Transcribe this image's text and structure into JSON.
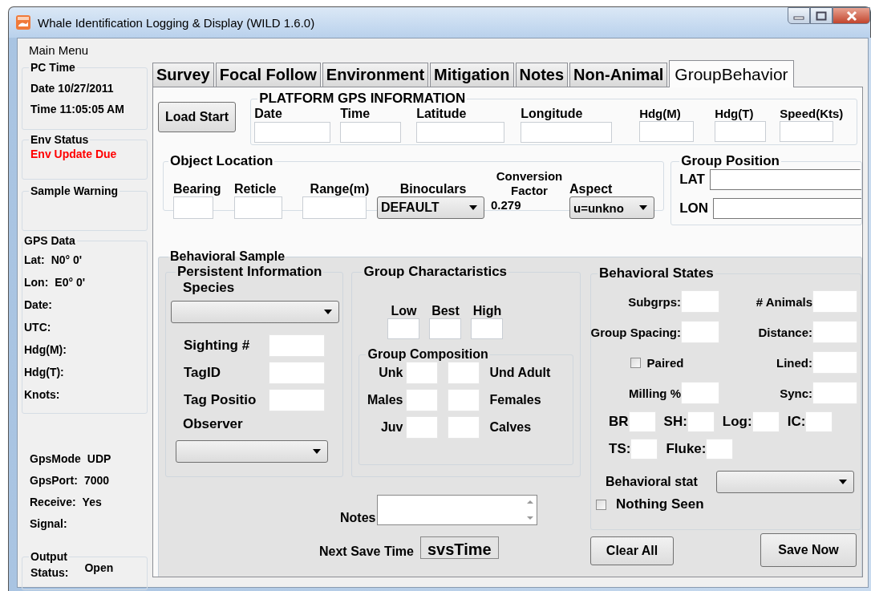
{
  "window": {
    "title": "Whale Identification Logging & Display (WILD 1.6.0)"
  },
  "menu": {
    "label": "Main Menu"
  },
  "sidebar": {
    "pc_time": {
      "title": "PC Time",
      "rows": [
        {
          "label": "Date",
          "value": "10/27/2011"
        },
        {
          "label": "Time",
          "value": "11:05:05 AM"
        }
      ]
    },
    "env_status": {
      "title": "Env Status",
      "message": "Env Update Due"
    },
    "sample_warning": {
      "title": "Sample Warning"
    },
    "gps_data": {
      "title": "GPS Data",
      "rows": [
        {
          "label": "Lat:",
          "value": "N0° 0'"
        },
        {
          "label": "Lon:",
          "value": "E0° 0'"
        },
        {
          "label": "Date:"
        },
        {
          "label": "UTC:"
        },
        {
          "label": "Hdg(M):"
        },
        {
          "label": "Hdg(T):"
        },
        {
          "label": "Knots:"
        }
      ]
    },
    "gps_settings": {
      "rows": [
        {
          "label": "GpsMode",
          "value": "UDP"
        },
        {
          "label": "GpsPort:",
          "value": "7000"
        },
        {
          "label": "Receive:",
          "value": "Yes"
        },
        {
          "label": "Signal:"
        }
      ]
    },
    "output": {
      "title": "Output",
      "label": "Status:",
      "value": "Open"
    }
  },
  "tabs": [
    {
      "label": "Survey",
      "selected": false
    },
    {
      "label": "Focal Follow",
      "selected": false
    },
    {
      "label": "Environment",
      "selected": false
    },
    {
      "label": "Mitigation",
      "selected": false
    },
    {
      "label": "Notes",
      "selected": false
    },
    {
      "label": "Non-Animal",
      "selected": false
    },
    {
      "label": "GroupBehavior",
      "selected": true
    }
  ],
  "load_button": "Load Start",
  "platform_gps": {
    "title": "PLATFORM GPS INFORMATION",
    "fields": [
      "Date",
      "Time",
      "Latitude",
      "Longitude",
      "Hdg(M)",
      "Hdg(T)",
      "Speed(Kts)"
    ]
  },
  "object_location": {
    "title": "Object Location",
    "fields": [
      {
        "kind": "input",
        "label": "Bearing"
      },
      {
        "kind": "input",
        "label": "Reticle"
      },
      {
        "kind": "input",
        "label": "Range(m)"
      },
      {
        "kind": "dropdown",
        "label": "Binoculars",
        "value": "DEFAULT"
      },
      {
        "kind": "readout",
        "label": "Conversion Factor",
        "value": "0.279"
      },
      {
        "kind": "dropdown",
        "label": "Aspect",
        "value": "u=unkno"
      }
    ]
  },
  "group_position": {
    "title": "Group Position",
    "fields": [
      "LAT",
      "LON"
    ]
  },
  "behavioral_sample": {
    "title": "Behavioral Sample",
    "persistent": {
      "title": "Persistent Information",
      "species_label": "Species",
      "fields": [
        "Sighting #",
        "TagID",
        "Tag Positio"
      ],
      "observer_label": "Observer"
    },
    "group_characteristics": {
      "title": "Group Charactaristics",
      "estimates": [
        "Low",
        "Best",
        "High"
      ],
      "composition": {
        "title": "Group Composition",
        "rows": [
          {
            "left": "Unk",
            "right": "Und Adult"
          },
          {
            "left": "Males",
            "right": "Females"
          },
          {
            "left": "Juv",
            "right": "Calves"
          }
        ]
      }
    },
    "behavioral_states": {
      "title": "Behavioral States",
      "pairs": [
        [
          {
            "kind": "input",
            "label": "Subgrps:"
          },
          {
            "kind": "input",
            "label": "# Animals"
          }
        ],
        [
          {
            "kind": "input",
            "label": "Group Spacing:"
          },
          {
            "kind": "input",
            "label": "Distance:"
          }
        ],
        [
          {
            "kind": "checkbox",
            "label": "Paired",
            "checked": false
          },
          {
            "kind": "input",
            "label": "Lined:"
          }
        ],
        [
          {
            "kind": "input",
            "label": "Milling %"
          },
          {
            "kind": "input",
            "label": "Sync:"
          }
        ]
      ],
      "small_rows": [
        [
          "BR",
          "SH:",
          "Log:",
          "IC:"
        ],
        [
          "TS:",
          "Fluke:"
        ]
      ],
      "state_label": "Behavioral stat",
      "nothing_seen": {
        "label": "Nothing Seen",
        "checked": false
      }
    },
    "notes_label": "Notes",
    "next_save_label": "Next Save Time",
    "next_save_value": "svsTime"
  },
  "buttons": [
    "Clear All",
    "Save Now"
  ]
}
